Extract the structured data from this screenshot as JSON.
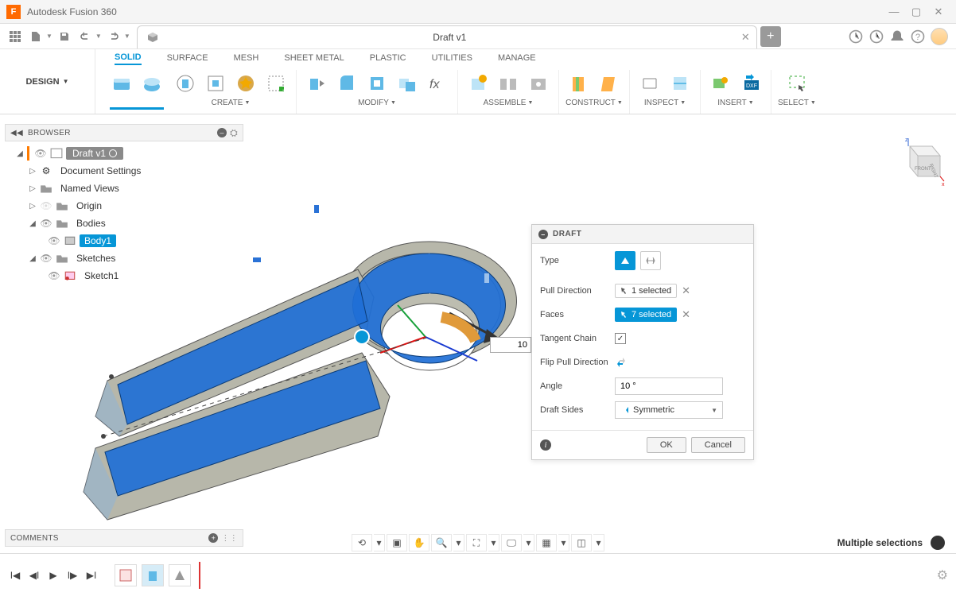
{
  "app": {
    "title": "Autodesk Fusion 360"
  },
  "document": {
    "tab_title": "Draft v1"
  },
  "workspace": {
    "label": "DESIGN"
  },
  "ribbon": {
    "tabs": [
      "SOLID",
      "SURFACE",
      "MESH",
      "SHEET METAL",
      "PLASTIC",
      "UTILITIES",
      "MANAGE"
    ],
    "active_tab": "SOLID",
    "groups": {
      "create": "CREATE",
      "modify": "MODIFY",
      "assemble": "ASSEMBLE",
      "construct": "CONSTRUCT",
      "inspect": "INSPECT",
      "insert": "INSERT",
      "select": "SELECT"
    }
  },
  "browser": {
    "title": "BROWSER",
    "root": "Draft v1",
    "doc_settings": "Document Settings",
    "named_views": "Named Views",
    "origin": "Origin",
    "bodies": "Bodies",
    "body1": "Body1",
    "sketches": "Sketches",
    "sketch1": "Sketch1"
  },
  "draft_dialog": {
    "title": "DRAFT",
    "type_label": "Type",
    "pull_direction_label": "Pull Direction",
    "pull_direction_value": "1 selected",
    "faces_label": "Faces",
    "faces_value": "7 selected",
    "tangent_chain_label": "Tangent Chain",
    "tangent_chain_checked": true,
    "flip_label": "Flip Pull Direction",
    "angle_label": "Angle",
    "angle_value": "10 °",
    "draft_sides_label": "Draft Sides",
    "draft_sides_value": "Symmetric",
    "ok": "OK",
    "cancel": "Cancel"
  },
  "canvas": {
    "angle_input": "10"
  },
  "comments": {
    "title": "COMMENTS"
  },
  "status": {
    "selection": "Multiple selections"
  },
  "viewcube": {
    "front": "FRONT",
    "right": "RIGHT",
    "z": "z",
    "x": "x"
  }
}
